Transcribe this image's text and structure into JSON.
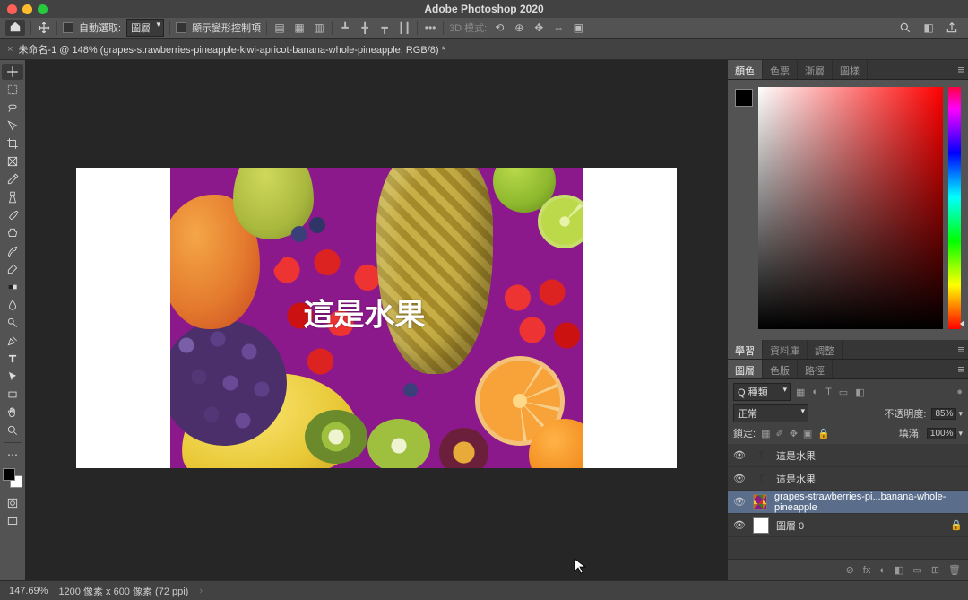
{
  "app_title": "Adobe Photoshop 2020",
  "optionsbar": {
    "auto_select_label": "自動選取:",
    "auto_select_target": "圖層",
    "show_transform_label": "顯示變形控制項",
    "mode_label": "3D 模式:"
  },
  "document_tab": {
    "close": "×",
    "title": "未命名-1 @ 148% (grapes-strawberries-pineapple-kiwi-apricot-banana-whole-pineapple, RGB/8) *"
  },
  "canvas": {
    "overlay_text": "這是水果"
  },
  "statusbar": {
    "zoom": "147.69%",
    "dimensions": "1200 像素 x 600 像素 (72 ppi)",
    "chevron": "›"
  },
  "panels": {
    "color_tabs": [
      "顏色",
      "色票",
      "漸層",
      "圖樣"
    ],
    "libraries_tabs": [
      "學習",
      "資料庫",
      "調整"
    ],
    "layers_tabs": [
      "圖層",
      "色版",
      "路徑"
    ],
    "layers": {
      "filter_label": "Q 種類",
      "blend_mode": "正常",
      "opacity_label": "不透明度:",
      "opacity_value": "85%",
      "lock_label": "鎖定:",
      "fill_label": "填滿:",
      "fill_value": "100%",
      "items": [
        {
          "type": "text",
          "name": "這是水果"
        },
        {
          "type": "text",
          "name": "這是水果"
        },
        {
          "type": "image",
          "name": "grapes-strawberries-pi...banana-whole-pineapple"
        },
        {
          "type": "bg",
          "name": "圖層 0"
        }
      ],
      "footer_icons": [
        "⊘",
        "fx",
        "◐",
        "◧",
        "▭",
        "⊞",
        "🗑"
      ]
    }
  }
}
